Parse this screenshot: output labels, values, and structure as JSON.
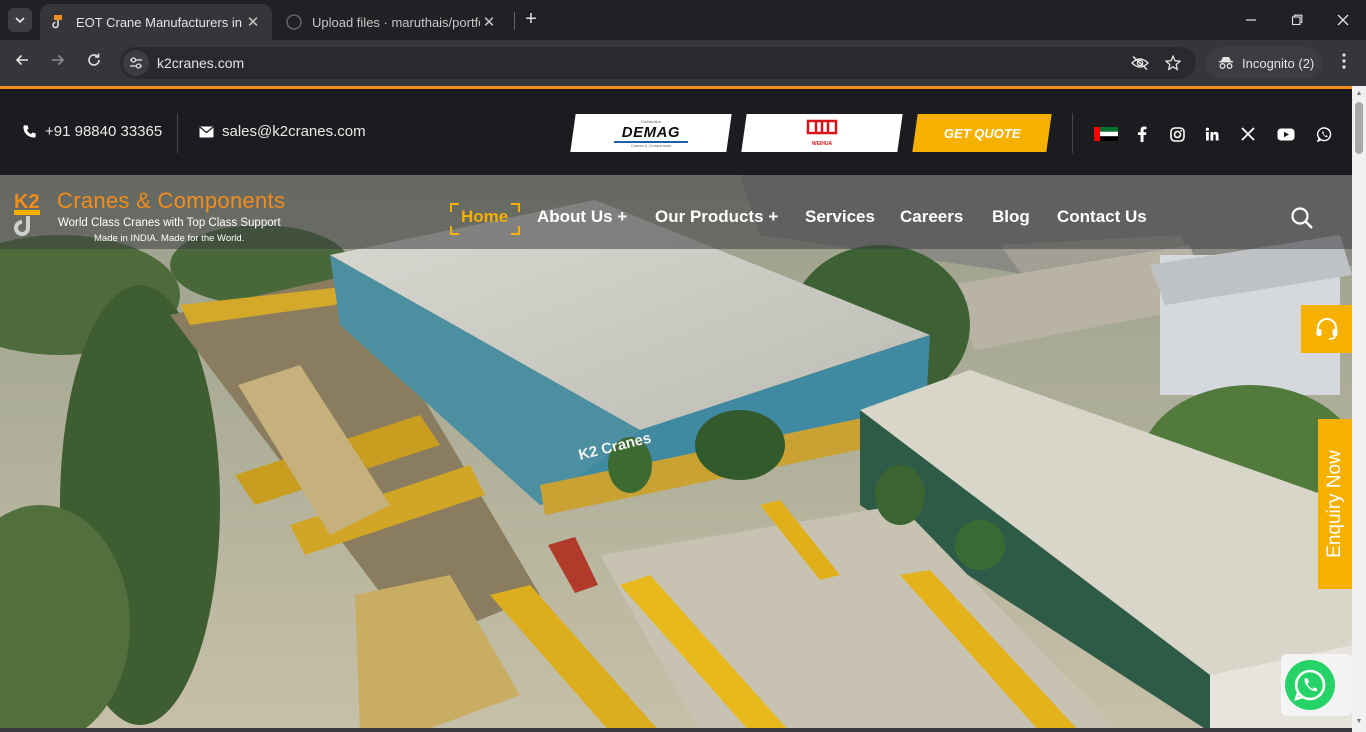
{
  "browser": {
    "tabs": [
      {
        "title": "EOT Crane Manufacturers in Ch",
        "active": true
      },
      {
        "title": "Upload files · maruthais/portfoli",
        "active": false
      }
    ],
    "url": "k2cranes.com",
    "incognito_label": "Incognito (2)"
  },
  "topbar": {
    "phone": "+91 98840 33365",
    "email": "sales@k2cranes.com",
    "partner1": "DEMAG",
    "partner1_small": "Distribution",
    "partner1_sub": "Cranes & Components",
    "partner2": "WEIHUA",
    "quote_label": "GET QUOTE"
  },
  "logo": {
    "mark": "K2",
    "name": "Cranes & Components",
    "tagline": "World Class Cranes with Top Class Support",
    "made": "Made in INDIA. Made for the World."
  },
  "nav": {
    "items": [
      {
        "label": "Home"
      },
      {
        "label": "About Us +"
      },
      {
        "label": "Our Products +"
      },
      {
        "label": "Services"
      },
      {
        "label": "Careers"
      },
      {
        "label": "Blog"
      },
      {
        "label": "Contact Us"
      }
    ]
  },
  "hero": {
    "building_sign": "K2 Cranes"
  },
  "enquiry_label": "Enquiry Now",
  "colors": {
    "accent": "#f6b100",
    "orange": "#f28c1a",
    "topbar_bg": "#1b1c1f",
    "whatsapp": "#25d366"
  }
}
